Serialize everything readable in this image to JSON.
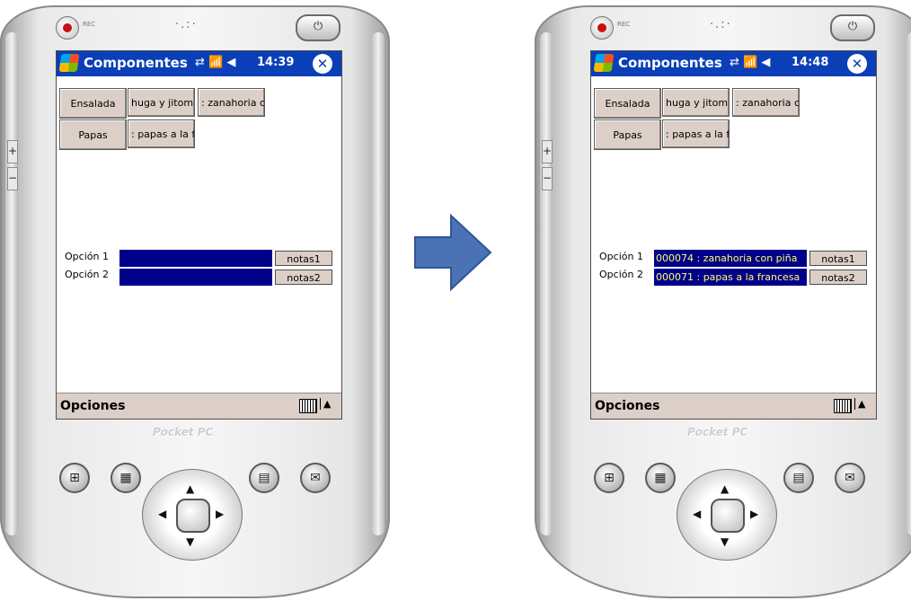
{
  "colors": {
    "titlebar": "#0a3fb8",
    "button_face": "#dccfc8",
    "option_field": "#00008b",
    "option_text": "#ffff66",
    "flow_arrow": "#4a72b5"
  },
  "device_left": {
    "rec_label": "REC",
    "title": "Componentes",
    "clock": "14:39",
    "dishes": [
      {
        "name": "Ensalada",
        "components": [
          "huga y jitom.",
          ": zanahoria c"
        ]
      },
      {
        "name": "Papas",
        "components": [
          ": papas a la f"
        ]
      }
    ],
    "options": [
      {
        "label": "Opción 1",
        "value": "",
        "notes": "notas1"
      },
      {
        "label": "Opción 2",
        "value": "",
        "notes": "notas2"
      }
    ],
    "menu_label": "Opciones",
    "brand": "Pocket PC"
  },
  "device_right": {
    "rec_label": "REC",
    "title": "Componentes",
    "clock": "14:48",
    "dishes": [
      {
        "name": "Ensalada",
        "components": [
          "huga y jitom.",
          ": zanahoria c"
        ]
      },
      {
        "name": "Papas",
        "components": [
          ": papas a la f"
        ]
      }
    ],
    "options": [
      {
        "label": "Opción 1",
        "value": "000074 : zanahoria con piña",
        "notes": "notas1"
      },
      {
        "label": "Opción 2",
        "value": "000071 : papas a la francesa",
        "notes": "notas2"
      }
    ],
    "menu_label": "Opciones",
    "brand": "Pocket PC"
  },
  "icons": [
    "windows-start-icon",
    "connectivity-icon",
    "signal-icon",
    "volume-icon",
    "close-icon",
    "keyboard-icon",
    "power-icon",
    "record-icon",
    "calendar-icon",
    "contacts-icon",
    "tasks-icon",
    "inbox-icon"
  ]
}
